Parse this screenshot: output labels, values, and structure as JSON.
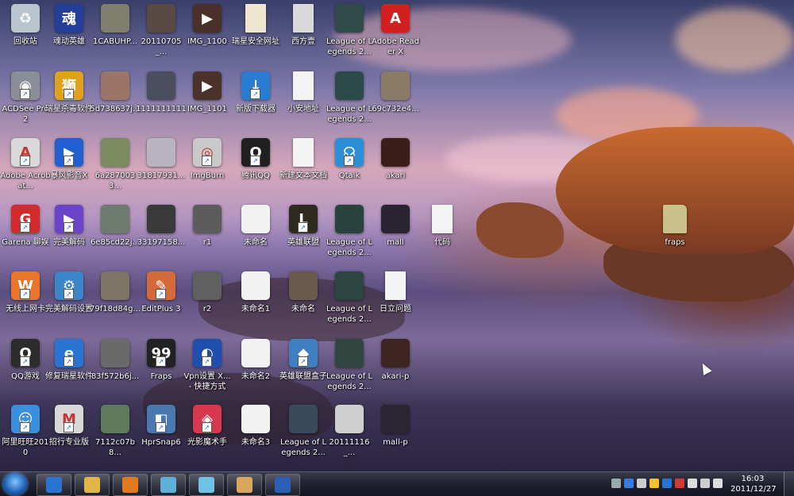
{
  "desktop": {
    "icons": [
      {
        "label": "回收站",
        "icon": "recycle-bin-icon",
        "color": "#b9c4cc",
        "glyph": "♻",
        "shortcut": false
      },
      {
        "label": "ACDSee Pro 2",
        "icon": "acdsee-icon",
        "color": "#8a8f97",
        "glyph": "◉",
        "shortcut": true
      },
      {
        "label": "Adobe Acrobat...",
        "icon": "acrobat-icon",
        "color": "#d9d9d9",
        "glyph": "A",
        "shortcut": true
      },
      {
        "label": "Garena 聊娱",
        "icon": "garena-icon",
        "color": "#d32b2b",
        "glyph": "G",
        "shortcut": true
      },
      {
        "label": "无线上网卡",
        "icon": "wo-icon",
        "color": "#e8752a",
        "glyph": "W",
        "shortcut": true
      },
      {
        "label": "QQ游戏",
        "icon": "qq-game-icon",
        "color": "#2c2c2c",
        "glyph": "Q",
        "shortcut": true
      },
      {
        "label": "阿里旺旺2010",
        "icon": "aliwangwang-icon",
        "color": "#3b8fe0",
        "glyph": "☺",
        "shortcut": true
      },
      {
        "label": "魂动英雄",
        "icon": "game-icon",
        "color": "#243f9a",
        "glyph": "魂",
        "shortcut": false
      },
      {
        "label": "瑞星杀毒软件",
        "icon": "rising-antivirus-icon",
        "color": "#e0a21c",
        "glyph": "狮",
        "shortcut": true
      },
      {
        "label": "暴风影音X",
        "icon": "baofeng-icon",
        "color": "#1f5fcf",
        "glyph": "▶",
        "shortcut": true
      },
      {
        "label": "完美解码",
        "icon": "media-player-icon",
        "color": "#6a43c8",
        "glyph": "▶",
        "shortcut": true
      },
      {
        "label": "完美解码设置",
        "icon": "settings-icon",
        "color": "#3a86c9",
        "glyph": "⚙",
        "shortcut": true
      },
      {
        "label": "修复瑞星软件",
        "icon": "ie-icon",
        "color": "#2a74d1",
        "glyph": "e",
        "shortcut": true
      },
      {
        "label": "招行专业版",
        "icon": "cmb-icon",
        "color": "#d8d8d8",
        "glyph": "M",
        "shortcut": true
      },
      {
        "label": "1CABUHP...",
        "icon": "image-thumb-icon",
        "color": "#7f7f6e",
        "glyph": "",
        "shortcut": false
      },
      {
        "label": "5d738637j...",
        "icon": "image-thumb-icon",
        "color": "#9a7568",
        "glyph": "",
        "shortcut": false
      },
      {
        "label": "6a2870033...",
        "icon": "image-thumb-icon",
        "color": "#7b8a5f",
        "glyph": "",
        "shortcut": false
      },
      {
        "label": "6e85cd22j...",
        "icon": "image-thumb-icon",
        "color": "#6e7a70",
        "glyph": "",
        "shortcut": false
      },
      {
        "label": "79f18d84g...",
        "icon": "image-thumb-icon",
        "color": "#7c7464",
        "glyph": "",
        "shortcut": false
      },
      {
        "label": "83f572b6j...",
        "icon": "image-thumb-icon",
        "color": "#6a6a6a",
        "glyph": "",
        "shortcut": false
      },
      {
        "label": "7112c07b8...",
        "icon": "image-thumb-icon",
        "color": "#5f7a5a",
        "glyph": "",
        "shortcut": false
      },
      {
        "label": "20110705_...",
        "icon": "image-thumb-icon",
        "color": "#5a4a46",
        "glyph": "",
        "shortcut": false
      },
      {
        "label": "1111111111",
        "icon": "image-thumb-icon",
        "color": "#4b4e5e",
        "glyph": "",
        "shortcut": false
      },
      {
        "label": "31817931...",
        "icon": "image-thumb-icon",
        "color": "#b8b4c0",
        "glyph": "",
        "shortcut": false
      },
      {
        "label": "33197158...",
        "icon": "image-thumb-icon",
        "color": "#3a3a3a",
        "glyph": "",
        "shortcut": false
      },
      {
        "label": "EditPlus 3",
        "icon": "editplus-icon",
        "color": "#d46a3a",
        "glyph": "✎",
        "shortcut": true
      },
      {
        "label": "Fraps",
        "icon": "fraps-icon",
        "color": "#222",
        "glyph": "99",
        "shortcut": true
      },
      {
        "label": "HprSnap6",
        "icon": "hypersnap-icon",
        "color": "#4a78b0",
        "glyph": "◧",
        "shortcut": true
      },
      {
        "label": "IMG_1100",
        "icon": "video-icon",
        "color": "#4a2f2a",
        "glyph": "▶",
        "shortcut": false
      },
      {
        "label": "IMG_1101",
        "icon": "video-icon",
        "color": "#4b332c",
        "glyph": "▶",
        "shortcut": false
      },
      {
        "label": "ImgBurn",
        "icon": "imgburn-icon",
        "color": "#c9c9c9",
        "glyph": "◎",
        "shortcut": true
      },
      {
        "label": "r1",
        "icon": "image-thumb-icon",
        "color": "#5c5c5c",
        "glyph": "",
        "shortcut": false
      },
      {
        "label": "r2",
        "icon": "image-thumb-icon",
        "color": "#606060",
        "glyph": "",
        "shortcut": false
      },
      {
        "label": "Vpn设置 X... - 快捷方式",
        "icon": "vpn-icon",
        "color": "#1e4fae",
        "glyph": "◐",
        "shortcut": true
      },
      {
        "label": "光影魔术手",
        "icon": "photo-editor-icon",
        "color": "#d7384f",
        "glyph": "◈",
        "shortcut": true
      },
      {
        "label": "瑞星安全网址",
        "icon": "document-icon",
        "color": "#f0e6d0",
        "glyph": "",
        "shortcut": false
      },
      {
        "label": "新版下载器",
        "icon": "downloader-icon",
        "color": "#2a7bd2",
        "glyph": "↓",
        "shortcut": true
      },
      {
        "label": "腾讯QQ",
        "icon": "qq-icon",
        "color": "#202020",
        "glyph": "Q",
        "shortcut": true
      },
      {
        "label": "未命名",
        "icon": "image-thumb-icon",
        "color": "#f2f2f2",
        "glyph": "",
        "shortcut": false
      },
      {
        "label": "未命名1",
        "icon": "image-thumb-icon",
        "color": "#f2f2f2",
        "glyph": "",
        "shortcut": false
      },
      {
        "label": "未命名2",
        "icon": "image-thumb-icon",
        "color": "#f2f2f2",
        "glyph": "",
        "shortcut": false
      },
      {
        "label": "未命名3",
        "icon": "image-thumb-icon",
        "color": "#f2f2f2",
        "glyph": "",
        "shortcut": false
      },
      {
        "label": "西方壹",
        "icon": "document-icon",
        "color": "#d9d9d9",
        "glyph": "",
        "shortcut": false
      },
      {
        "label": "小安地址",
        "icon": "text-file-icon",
        "color": "#f4f4f4",
        "glyph": "",
        "shortcut": false
      },
      {
        "label": "新建文本文档",
        "icon": "text-file-icon",
        "color": "#f4f4f4",
        "glyph": "",
        "shortcut": false
      },
      {
        "label": "英雄联盟",
        "icon": "lol-icon",
        "color": "#2f2a20",
        "glyph": "L",
        "shortcut": true
      },
      {
        "label": "未命名",
        "icon": "image-thumb-icon",
        "color": "#6a5a4e",
        "glyph": "",
        "shortcut": false
      },
      {
        "label": "英雄联盟盒子",
        "icon": "lol-box-icon",
        "color": "#3f7ec0",
        "glyph": "◆",
        "shortcut": true
      },
      {
        "label": "League of Legends 2...",
        "icon": "image-thumb-icon",
        "color": "#3a4a5c",
        "glyph": "",
        "shortcut": false
      },
      {
        "label": "League of Legends 2...",
        "icon": "image-thumb-icon",
        "color": "#2f4a48",
        "glyph": "",
        "shortcut": false
      },
      {
        "label": "League of Legends 2...",
        "icon": "image-thumb-icon",
        "color": "#2c4a4a",
        "glyph": "",
        "shortcut": false
      },
      {
        "label": "Qtalk",
        "icon": "qtalk-icon",
        "color": "#2b8fd8",
        "glyph": "☊",
        "shortcut": true
      },
      {
        "label": "League of Legends 2...",
        "icon": "image-thumb-icon",
        "color": "#28423e",
        "glyph": "",
        "shortcut": false
      },
      {
        "label": "League of Legends 2...",
        "icon": "image-thumb-icon",
        "color": "#2d4540",
        "glyph": "",
        "shortcut": false
      },
      {
        "label": "League of Legends 2...",
        "icon": "image-thumb-icon",
        "color": "#30463f",
        "glyph": "",
        "shortcut": false
      },
      {
        "label": "20111116_...",
        "icon": "image-thumb-icon",
        "color": "#cfcfcf",
        "glyph": "",
        "shortcut": false
      },
      {
        "label": "Adobe Reader X",
        "icon": "adobe-reader-icon",
        "color": "#d21f1f",
        "glyph": "A",
        "shortcut": false
      },
      {
        "label": "69c732e4...",
        "icon": "image-thumb-icon",
        "color": "#8b7a66",
        "glyph": "",
        "shortcut": false
      },
      {
        "label": "akari",
        "icon": "image-thumb-icon",
        "color": "#3b1e1a",
        "glyph": "",
        "shortcut": false
      },
      {
        "label": "mall",
        "icon": "image-thumb-icon",
        "color": "#2a2432",
        "glyph": "",
        "shortcut": false
      },
      {
        "label": "日立问题",
        "icon": "text-file-icon",
        "color": "#f4f4f4",
        "glyph": "",
        "shortcut": false
      },
      {
        "label": "akari-p",
        "icon": "image-thumb-icon",
        "color": "#3f2522",
        "glyph": "",
        "shortcut": false
      },
      {
        "label": "mall-p",
        "icon": "image-thumb-icon",
        "color": "#2b2433",
        "glyph": "",
        "shortcut": false
      },
      {
        "label": "代码",
        "icon": "text-file-icon",
        "color": "#f4f4f4",
        "glyph": "",
        "shortcut": false
      },
      {
        "label": "fraps",
        "icon": "folder-icon",
        "color": "#c9c08a",
        "glyph": "",
        "shortcut": false
      }
    ]
  },
  "taskbar": {
    "pinned": [
      {
        "name": "ie-taskbar-icon",
        "color": "#2a74d1"
      },
      {
        "name": "explorer-taskbar-icon",
        "color": "#e0b54a"
      },
      {
        "name": "media-player-taskbar-icon",
        "color": "#e07a1f"
      },
      {
        "name": "network-taskbar-icon",
        "color": "#5fb0d8"
      },
      {
        "name": "app-taskbar-icon",
        "color": "#6fc2e6"
      },
      {
        "name": "media-center-taskbar-icon",
        "color": "#d9a65e"
      },
      {
        "name": "word-taskbar-icon",
        "color": "#2b5fb5"
      }
    ],
    "tray": [
      {
        "name": "keyboard-tray-icon",
        "color": "#9aa"
      },
      {
        "name": "help-tray-icon",
        "color": "#3a7be0"
      },
      {
        "name": "show-hidden-tray-icon",
        "color": "#ccc"
      },
      {
        "name": "qq-tray-icon",
        "color": "#f2c22e"
      },
      {
        "name": "baofeng-tray-icon",
        "color": "#2a74d1"
      },
      {
        "name": "antivirus-tray-icon",
        "color": "#d23a3a"
      },
      {
        "name": "flag-tray-icon",
        "color": "#dddddd"
      },
      {
        "name": "network-tray-icon",
        "color": "#cccccc"
      },
      {
        "name": "volume-tray-icon",
        "color": "#dddddd"
      }
    ],
    "clock": {
      "time": "16:03",
      "date": "2011/12/27"
    }
  }
}
